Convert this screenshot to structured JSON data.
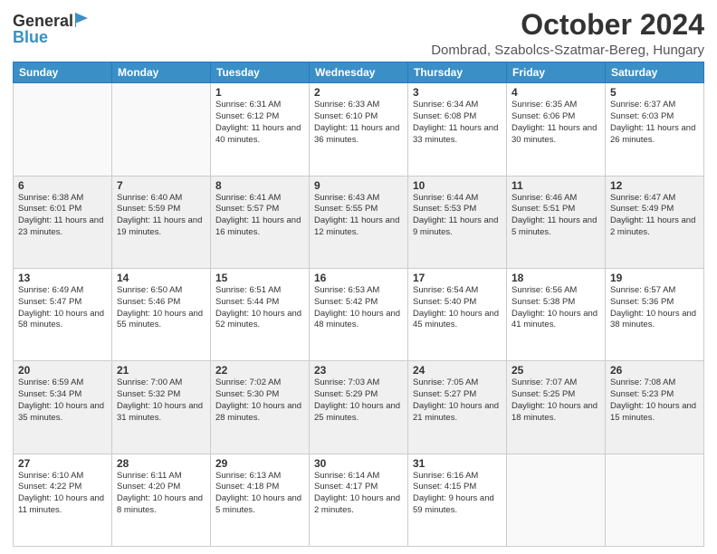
{
  "logo": {
    "general": "General",
    "blue": "Blue"
  },
  "title": "October 2024",
  "subtitle": "Dombrad, Szabolcs-Szatmar-Bereg, Hungary",
  "days_of_week": [
    "Sunday",
    "Monday",
    "Tuesday",
    "Wednesday",
    "Thursday",
    "Friday",
    "Saturday"
  ],
  "weeks": [
    [
      {
        "day": "",
        "info": ""
      },
      {
        "day": "",
        "info": ""
      },
      {
        "day": "1",
        "info": "Sunrise: 6:31 AM\nSunset: 6:12 PM\nDaylight: 11 hours and 40 minutes."
      },
      {
        "day": "2",
        "info": "Sunrise: 6:33 AM\nSunset: 6:10 PM\nDaylight: 11 hours and 36 minutes."
      },
      {
        "day": "3",
        "info": "Sunrise: 6:34 AM\nSunset: 6:08 PM\nDaylight: 11 hours and 33 minutes."
      },
      {
        "day": "4",
        "info": "Sunrise: 6:35 AM\nSunset: 6:06 PM\nDaylight: 11 hours and 30 minutes."
      },
      {
        "day": "5",
        "info": "Sunrise: 6:37 AM\nSunset: 6:03 PM\nDaylight: 11 hours and 26 minutes."
      }
    ],
    [
      {
        "day": "6",
        "info": "Sunrise: 6:38 AM\nSunset: 6:01 PM\nDaylight: 11 hours and 23 minutes."
      },
      {
        "day": "7",
        "info": "Sunrise: 6:40 AM\nSunset: 5:59 PM\nDaylight: 11 hours and 19 minutes."
      },
      {
        "day": "8",
        "info": "Sunrise: 6:41 AM\nSunset: 5:57 PM\nDaylight: 11 hours and 16 minutes."
      },
      {
        "day": "9",
        "info": "Sunrise: 6:43 AM\nSunset: 5:55 PM\nDaylight: 11 hours and 12 minutes."
      },
      {
        "day": "10",
        "info": "Sunrise: 6:44 AM\nSunset: 5:53 PM\nDaylight: 11 hours and 9 minutes."
      },
      {
        "day": "11",
        "info": "Sunrise: 6:46 AM\nSunset: 5:51 PM\nDaylight: 11 hours and 5 minutes."
      },
      {
        "day": "12",
        "info": "Sunrise: 6:47 AM\nSunset: 5:49 PM\nDaylight: 11 hours and 2 minutes."
      }
    ],
    [
      {
        "day": "13",
        "info": "Sunrise: 6:49 AM\nSunset: 5:47 PM\nDaylight: 10 hours and 58 minutes."
      },
      {
        "day": "14",
        "info": "Sunrise: 6:50 AM\nSunset: 5:46 PM\nDaylight: 10 hours and 55 minutes."
      },
      {
        "day": "15",
        "info": "Sunrise: 6:51 AM\nSunset: 5:44 PM\nDaylight: 10 hours and 52 minutes."
      },
      {
        "day": "16",
        "info": "Sunrise: 6:53 AM\nSunset: 5:42 PM\nDaylight: 10 hours and 48 minutes."
      },
      {
        "day": "17",
        "info": "Sunrise: 6:54 AM\nSunset: 5:40 PM\nDaylight: 10 hours and 45 minutes."
      },
      {
        "day": "18",
        "info": "Sunrise: 6:56 AM\nSunset: 5:38 PM\nDaylight: 10 hours and 41 minutes."
      },
      {
        "day": "19",
        "info": "Sunrise: 6:57 AM\nSunset: 5:36 PM\nDaylight: 10 hours and 38 minutes."
      }
    ],
    [
      {
        "day": "20",
        "info": "Sunrise: 6:59 AM\nSunset: 5:34 PM\nDaylight: 10 hours and 35 minutes."
      },
      {
        "day": "21",
        "info": "Sunrise: 7:00 AM\nSunset: 5:32 PM\nDaylight: 10 hours and 31 minutes."
      },
      {
        "day": "22",
        "info": "Sunrise: 7:02 AM\nSunset: 5:30 PM\nDaylight: 10 hours and 28 minutes."
      },
      {
        "day": "23",
        "info": "Sunrise: 7:03 AM\nSunset: 5:29 PM\nDaylight: 10 hours and 25 minutes."
      },
      {
        "day": "24",
        "info": "Sunrise: 7:05 AM\nSunset: 5:27 PM\nDaylight: 10 hours and 21 minutes."
      },
      {
        "day": "25",
        "info": "Sunrise: 7:07 AM\nSunset: 5:25 PM\nDaylight: 10 hours and 18 minutes."
      },
      {
        "day": "26",
        "info": "Sunrise: 7:08 AM\nSunset: 5:23 PM\nDaylight: 10 hours and 15 minutes."
      }
    ],
    [
      {
        "day": "27",
        "info": "Sunrise: 6:10 AM\nSunset: 4:22 PM\nDaylight: 10 hours and 11 minutes."
      },
      {
        "day": "28",
        "info": "Sunrise: 6:11 AM\nSunset: 4:20 PM\nDaylight: 10 hours and 8 minutes."
      },
      {
        "day": "29",
        "info": "Sunrise: 6:13 AM\nSunset: 4:18 PM\nDaylight: 10 hours and 5 minutes."
      },
      {
        "day": "30",
        "info": "Sunrise: 6:14 AM\nSunset: 4:17 PM\nDaylight: 10 hours and 2 minutes."
      },
      {
        "day": "31",
        "info": "Sunrise: 6:16 AM\nSunset: 4:15 PM\nDaylight: 9 hours and 59 minutes."
      },
      {
        "day": "",
        "info": ""
      },
      {
        "day": "",
        "info": ""
      }
    ]
  ]
}
